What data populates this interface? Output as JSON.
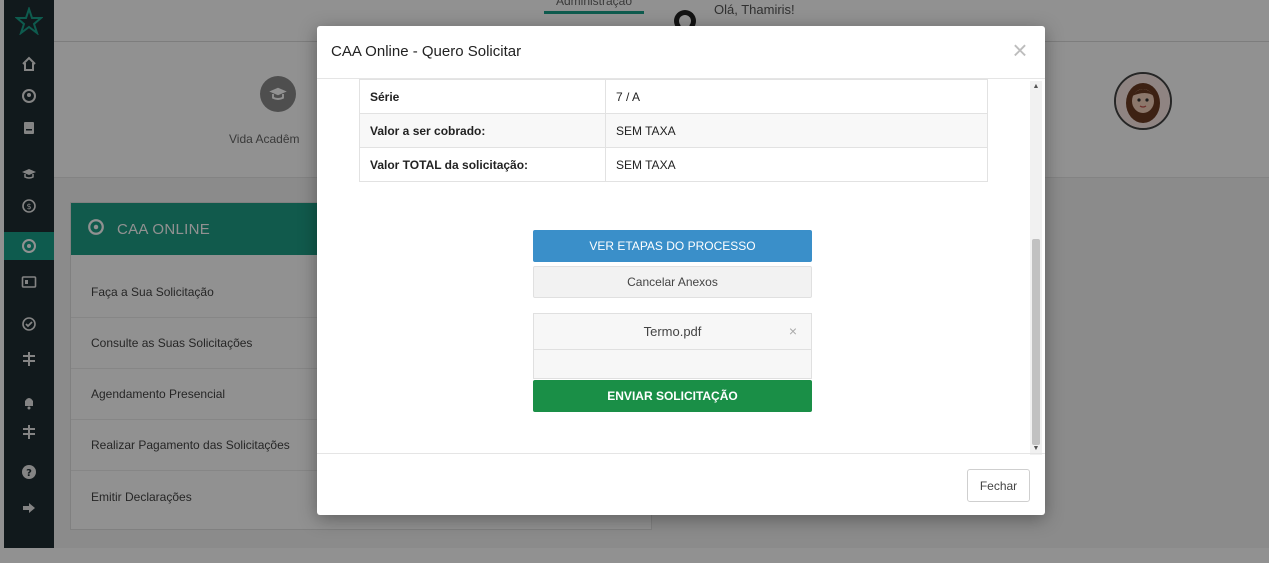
{
  "topbar": {
    "tab_label": "Administração",
    "greeting": "Olá, Thamiris!"
  },
  "header": {
    "vida_label": "Vida Acadêm"
  },
  "panel": {
    "title": "CAA ONLINE",
    "items": [
      {
        "label": "Faça a Sua Solicitação"
      },
      {
        "label": "Consulte as Suas Solicitações"
      },
      {
        "label": "Agendamento Presencial"
      },
      {
        "label": "Realizar Pagamento das Solicitações"
      },
      {
        "label": "Emitir Declarações"
      }
    ]
  },
  "sidebar": {
    "icons": [
      "logo-star-icon",
      "home-icon",
      "user-icon",
      "book-icon",
      "graduation-cap-icon",
      "coin-icon",
      "caa-icon",
      "id-card-icon",
      "check-icon",
      "signpost-icon",
      "bell-icon",
      "signpost-icon",
      "help-icon",
      "logout-icon"
    ],
    "accent_color": "#19a089"
  },
  "modal": {
    "title": "CAA Online - Quero Solicitar",
    "close_symbol": "×",
    "table": [
      {
        "label": "Série",
        "value": "7 / A"
      },
      {
        "label": "Valor a ser cobrado:",
        "value": "SEM TAXA"
      },
      {
        "label": "Valor TOTAL da solicitação:",
        "value": "SEM TAXA"
      }
    ],
    "btn_etapas": "VER ETAPAS DO PROCESSO",
    "btn_cancelar": "Cancelar Anexos",
    "file_name": "Termo.pdf",
    "file_remove": "×",
    "btn_enviar": "ENVIAR SOLICITAÇÃO",
    "btn_fechar": "Fechar",
    "colors": {
      "blue": "#3a8fc9",
      "green": "#1a8f47"
    }
  }
}
